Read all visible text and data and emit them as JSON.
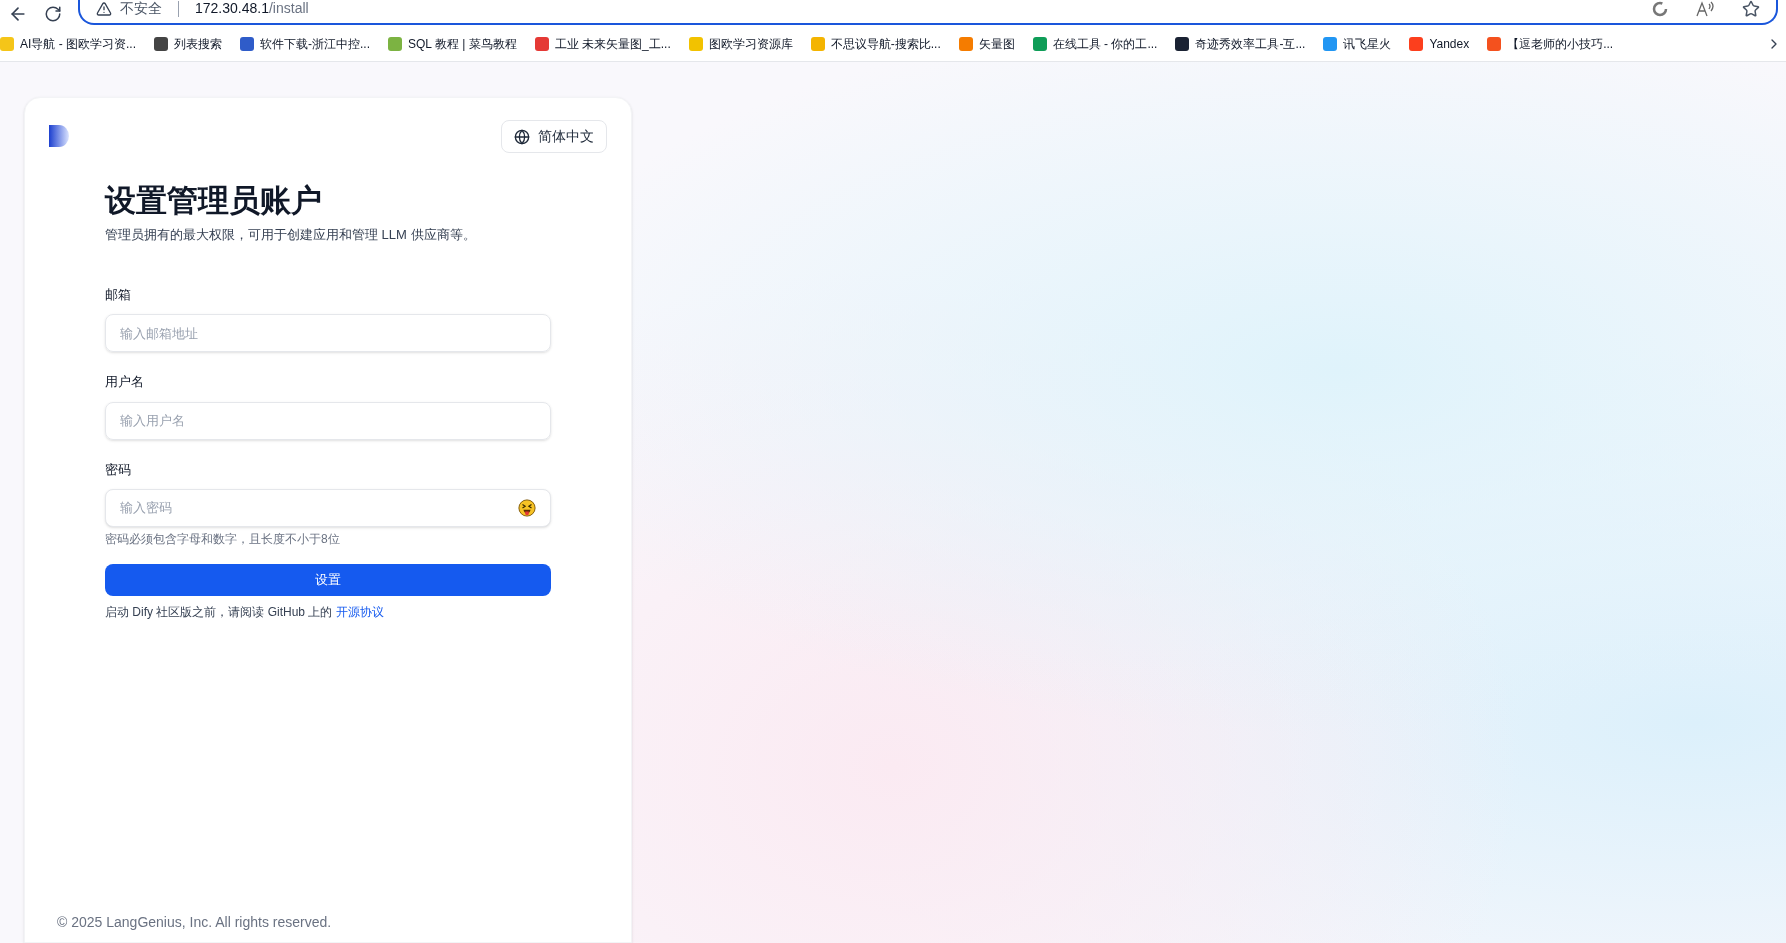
{
  "browser": {
    "security_label": "不安全",
    "url_host": "172.30.48.1",
    "url_path": "/install"
  },
  "bookmarks": [
    {
      "label": "AI导航 - 图欧学习资...",
      "color": "#f5c518"
    },
    {
      "label": "列表搜索",
      "color": "#444444"
    },
    {
      "label": "软件下载-浙江中控...",
      "color": "#2f5cc9"
    },
    {
      "label": "SQL 教程 | 菜鸟教程",
      "color": "#7cb342"
    },
    {
      "label": "工业 未来矢量图_工...",
      "color": "#e53935"
    },
    {
      "label": "图欧学习资源库",
      "color": "#f2c200"
    },
    {
      "label": "不思议导航-搜索比...",
      "color": "#f4b400"
    },
    {
      "label": "矢量图",
      "color": "#f57c00"
    },
    {
      "label": "在线工具 - 你的工...",
      "color": "#0f9d58"
    },
    {
      "label": "奇迹秀效率工具-互...",
      "color": "#1a2233"
    },
    {
      "label": "讯飞星火",
      "color": "#2196f3"
    },
    {
      "label": "Yandex",
      "color": "#fc3f1d"
    },
    {
      "label": "【逗老师的小技巧...",
      "color": "#f4511e"
    }
  ],
  "language_button": "简体中文",
  "title": "设置管理员账户",
  "subtitle": "管理员拥有的最大权限，可用于创建应用和管理 LLM 供应商等。",
  "fields": [
    {
      "label": "邮箱",
      "placeholder": "输入邮箱地址",
      "kind": "text"
    },
    {
      "label": "用户名",
      "placeholder": "输入用户名",
      "kind": "text"
    },
    {
      "label": "密码",
      "placeholder": "输入密码",
      "kind": "password",
      "hint": "密码必须包含字母和数字，且长度不小于8位"
    }
  ],
  "submit_button": "设置",
  "notice": {
    "text": "启动 Dify 社区版之前，请阅读 GitHub 上的",
    "link": "开源协议"
  },
  "footer": "© 2025 LangGenius, Inc. All rights reserved."
}
